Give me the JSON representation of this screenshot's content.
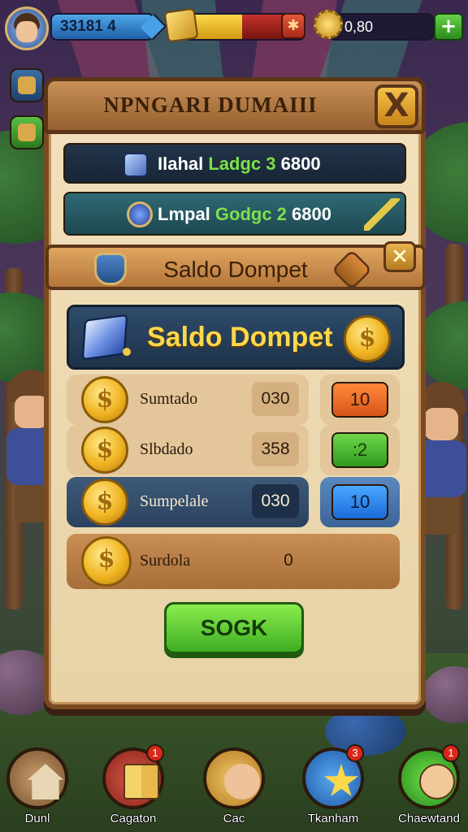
{
  "hud": {
    "xp_text": "33181 4",
    "gold_fill_pct": 48,
    "gem_text": "0,80"
  },
  "dialog": {
    "title": "NPNGARI DUMAIII",
    "close_glyph": "X",
    "rows": [
      {
        "label_main": "Ilahal ",
        "label_green": "Ladgc 3",
        "label_amount": " 6800"
      },
      {
        "label_main": "Lmpal ",
        "label_green": "Godgc 2",
        "label_amount": " 6800"
      }
    ]
  },
  "wallet_panel": {
    "header_title": "Saldo Dompet",
    "close_glyph": "×",
    "banner_title": "Saldo Dompet",
    "entries": [
      {
        "name": "Sumtado",
        "value": "030",
        "action": "10"
      },
      {
        "name": "Slbdado",
        "value": "358",
        "action": ":2"
      },
      {
        "name": "Sumpelale",
        "value": "030",
        "action": "10"
      },
      {
        "name": "Surdola",
        "value": "0"
      }
    ],
    "ok_label": "SOGK"
  },
  "nav": {
    "items": [
      {
        "label": "Dunl",
        "icon": "house-icon"
      },
      {
        "label": "Cagaton",
        "icon": "book-icon",
        "badge": "1"
      },
      {
        "label": "Cac",
        "icon": "hero-icon"
      },
      {
        "label": "Tkanham",
        "icon": "star-icon",
        "badge": "3"
      },
      {
        "label": "Chaewtand",
        "icon": "smile-icon",
        "badge": "1"
      }
    ]
  },
  "colors": {
    "panel": "#f2e1bd",
    "wood": "#7a4a22",
    "accent_gold": "#ffd84a",
    "button_green": "#3fae22",
    "button_orange": "#d8541a",
    "button_blue": "#1c6ad8"
  }
}
